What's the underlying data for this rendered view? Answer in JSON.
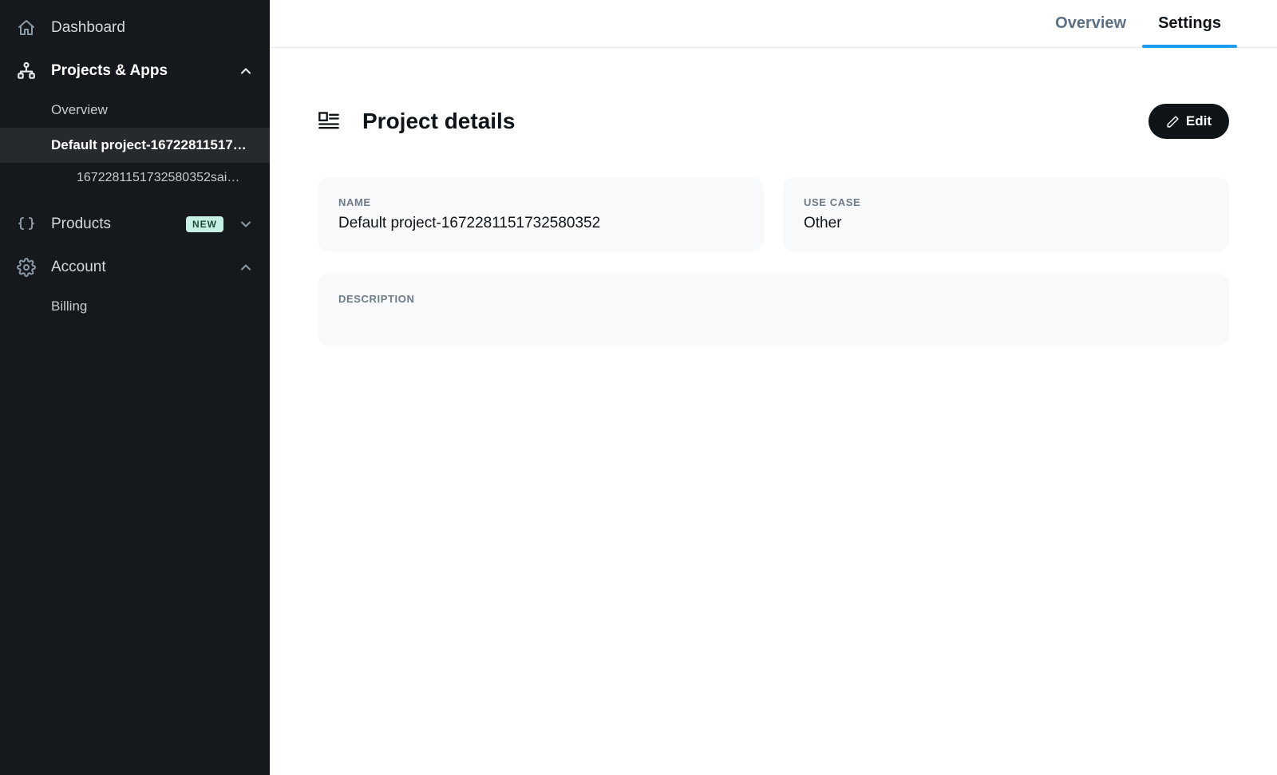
{
  "sidebar": {
    "dashboard": "Dashboard",
    "projects": {
      "label": "Projects & Apps",
      "open": true
    },
    "overview": "Overview",
    "project_item": "Default project-16722811517…",
    "app_item": "1672281151732580352sai…",
    "products": {
      "label": "Products",
      "badge": "NEW",
      "open": false
    },
    "account": {
      "label": "Account",
      "open": true
    },
    "billing": "Billing"
  },
  "tabs": {
    "overview": "Overview",
    "settings": "Settings",
    "active": "settings"
  },
  "section": {
    "title": "Project details",
    "edit": "Edit"
  },
  "cards": {
    "name_label": "NAME",
    "name_value": "Default project-1672281151732580352",
    "usecase_label": "USE CASE",
    "usecase_value": "Other",
    "description_label": "DESCRIPTION",
    "description_value": ""
  }
}
